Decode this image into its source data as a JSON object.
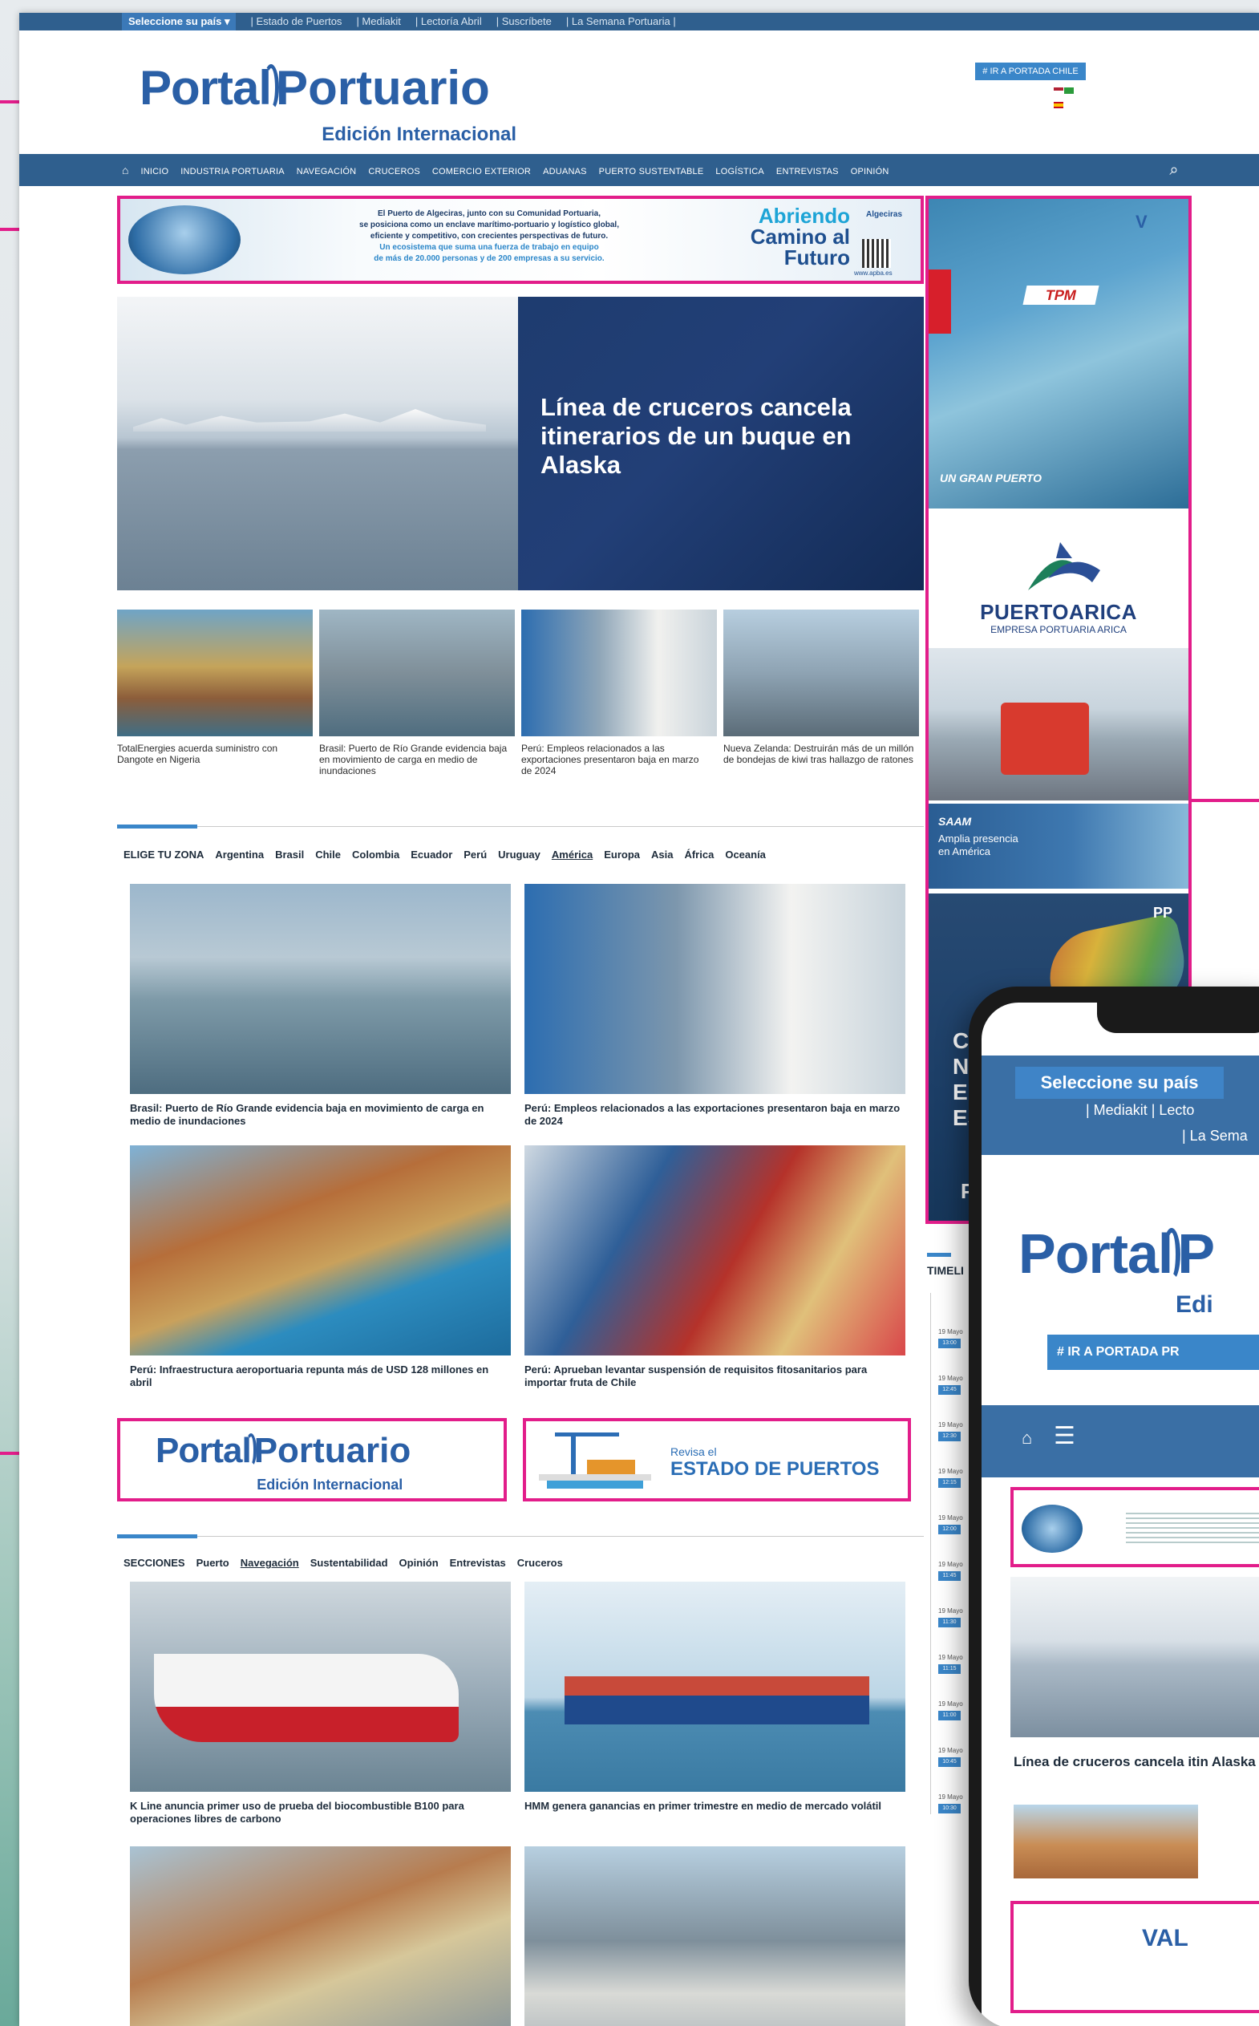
{
  "topbar": {
    "country_select": "Seleccione su país",
    "links": [
      "| Estado de Puertos",
      "| Mediakit",
      "| Lectoría Abril",
      "| Suscríbete",
      "| La Semana Portuaria |"
    ]
  },
  "header": {
    "logo_word1": "Portal",
    "logo_word2": "Portuario",
    "logo_sub": "Edición Internacional",
    "portada_button": "# IR A PORTADA CHILE"
  },
  "nav": {
    "items": [
      "INICIO",
      "INDUSTRIA PORTUARIA",
      "NAVEGACIÓN",
      "CRUCEROS",
      "COMERCIO EXTERIOR",
      "ADUANAS",
      "PUERTO SUSTENTABLE",
      "LOGÍSTICA",
      "ENTREVISTAS",
      "OPINIÓN"
    ]
  },
  "ad_top": {
    "text_lines": [
      "El Puerto de Algeciras, junto con su Comunidad Portuaria,",
      "se posiciona como un enclave marítimo-portuario y logístico global,",
      "eficiente y competitivo, con crecientes perspectivas de futuro.",
      "Un ecosistema que suma una fuerza de trabajo en equipo",
      "de más de 20.000 personas y de 200 empresas a su servicio."
    ],
    "slogan": [
      "Abriendo",
      "Camino al",
      "Futuro"
    ],
    "brand": "Algeciras",
    "url": "www.apba.es"
  },
  "hero": {
    "title": "Línea de cruceros cancela itinerarios de un buque en Alaska"
  },
  "thumbs": [
    {
      "caption": "TotalEnergies acuerda suministro con Dangote en Nigeria"
    },
    {
      "caption": "Brasil: Puerto de Río Grande evidencia baja en movimiento de carga en medio de inundaciones"
    },
    {
      "caption": "Perú: Empleos relacionados a las exportaciones presentaron baja en marzo de 2024"
    },
    {
      "caption": "Nueva Zelanda: Destruirán más de un millón de bondejas de kiwi tras hallazgo de ratones"
    }
  ],
  "zones": {
    "label": "ELIGE TU ZONA",
    "tabs": [
      "Argentina",
      "Brasil",
      "Chile",
      "Colombia",
      "Ecuador",
      "Perú",
      "Uruguay",
      "América",
      "Europa",
      "Asia",
      "África",
      "Oceanía"
    ]
  },
  "zone_cards": [
    {
      "caption": "Brasil: Puerto de Río Grande evidencia baja en movimiento de carga en medio de inundaciones"
    },
    {
      "caption": "Perú: Empleos relacionados a las exportaciones presentaron baja en marzo de 2024"
    },
    {
      "caption": "Perú: Infraestructura aeroportuaria repunta más de USD 128 millones en abril"
    },
    {
      "caption": "Perú: Aprueban levantar suspensión de requisitos fitosanitarios para importar fruta de Chile"
    }
  ],
  "ads_mid": {
    "estado_small": "Revisa el",
    "estado_big": "ESTADO DE PUERTOS"
  },
  "sections": {
    "label": "SECCIONES",
    "tabs": [
      "Puerto",
      "Navegación",
      "Sustentabilidad",
      "Opinión",
      "Entrevistas",
      "Cruceros"
    ]
  },
  "section_cards": [
    {
      "caption": "K Line anuncia primer uso de prueba del biocombustible B100 para operaciones libres de carbono"
    },
    {
      "caption": "HMM genera ganancias en primer trimestre en medio de mercado volátil"
    }
  ],
  "right_ads": {
    "tpm_logo": "TPM",
    "tpm_slogan": "UN GRAN PUERTO",
    "arica_title": "PUERTOARICA",
    "arica_sub": "EMPRESA PORTUARIA ARICA",
    "saam_logo": "SAAM",
    "saam_text": "Amplia presencia en América",
    "pp_mark": "PP",
    "pp_text": [
      "CON",
      "NU",
      "ED",
      "ES"
    ],
    "pp_extra": "P"
  },
  "timeline": {
    "title": "TIMELI",
    "items": [
      {
        "date": "19 Mayo",
        "time": "13:00"
      },
      {
        "date": "19 Mayo",
        "time": "12:45"
      },
      {
        "date": "19 Mayo",
        "time": "12:30"
      },
      {
        "date": "19 Mayo",
        "time": "12:15"
      },
      {
        "date": "19 Mayo",
        "time": "12:00"
      },
      {
        "date": "19 Mayo",
        "time": "11:45"
      },
      {
        "date": "19 Mayo",
        "time": "11:30"
      },
      {
        "date": "19 Mayo",
        "time": "11:15"
      },
      {
        "date": "19 Mayo",
        "time": "11:00"
      },
      {
        "date": "19 Mayo",
        "time": "10:45"
      },
      {
        "date": "19 Mayo",
        "time": "10:30"
      }
    ]
  },
  "phone": {
    "country": "Seleccione su país",
    "links1": "| Mediakit  | Lecto",
    "links2": "| La Sema",
    "logo_word1": "Portal",
    "logo_word2": "P",
    "logo_sub": "Edi",
    "portada_btn": "# IR A PORTADA PR",
    "hero_caption": "Línea de cruceros cancela itin Alaska",
    "bottom_logo": "VAL"
  },
  "colors": {
    "brand_blue": "#2f5f8e",
    "accent": "#3a86c9",
    "highlight": "#e21d8a"
  }
}
